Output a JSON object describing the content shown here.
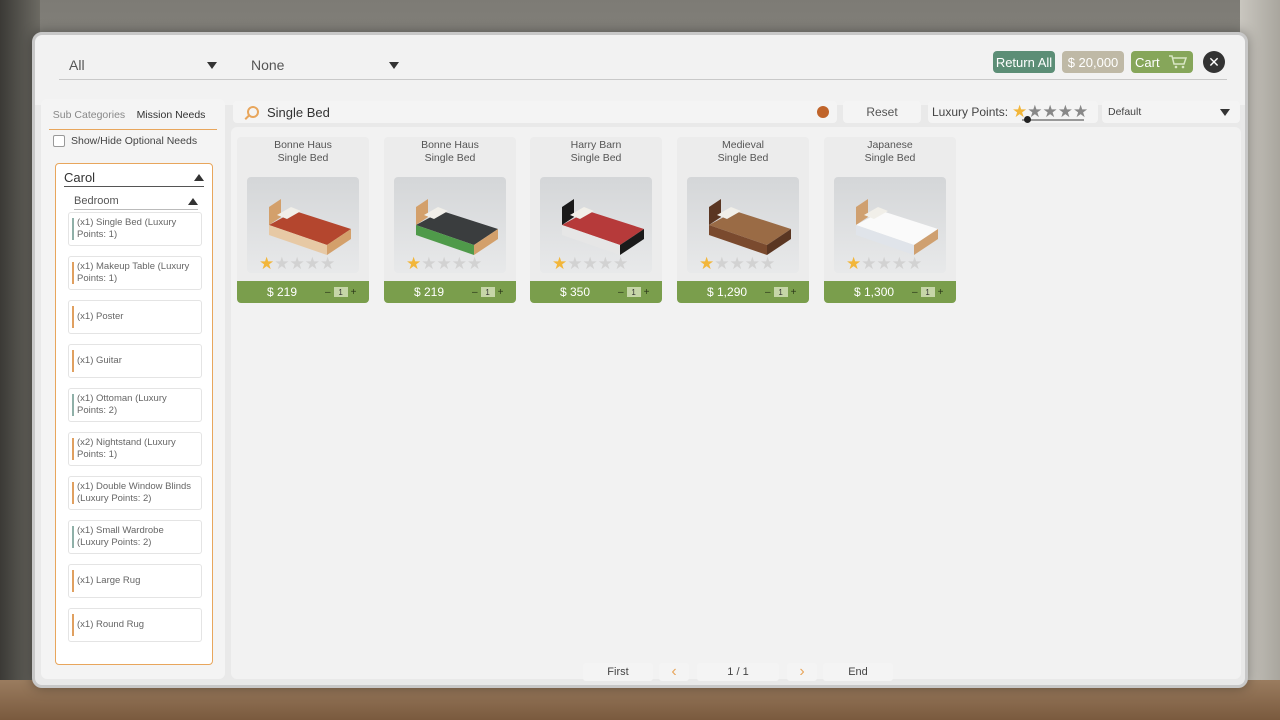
{
  "filters": {
    "category": "All",
    "subfilter": "None"
  },
  "top_actions": {
    "return_all": "Return All",
    "budget": "$ 20,000",
    "cart": "Cart",
    "close": "✕"
  },
  "sidebar": {
    "tabs": [
      "Sub Categories",
      "Mission Needs"
    ],
    "optional_toggle": "Show/Hide Optional Needs",
    "person": "Carol",
    "room": "Bedroom",
    "needs": [
      "(x1) Single Bed (Luxury Points: 1)",
      "(x1) Makeup Table (Luxury Points: 1)",
      "(x1) Poster",
      "(x1) Guitar",
      "(x1) Ottoman (Luxury Points: 2)",
      "(x2) Nightstand (Luxury Points: 1)",
      "(x1) Double Window Blinds (Luxury Points: 2)",
      "(x1) Small Wardrobe (Luxury Points: 2)",
      "(x1) Large Rug",
      "(x1) Round Rug"
    ]
  },
  "search": {
    "query": "Single Bed"
  },
  "reset": "Reset",
  "luxury": {
    "label": "Luxury Points:",
    "stars_filled": 1,
    "stars_total": 5
  },
  "sort": "Default",
  "products": [
    {
      "brand": "Bonne Haus",
      "name": "Single Bed",
      "price": "$ 219",
      "qty": "1",
      "stars": 1,
      "colors": {
        "frame": "#d3a06b",
        "bed": "#b4462e",
        "accent": "#e7c9a5"
      }
    },
    {
      "brand": "Bonne Haus",
      "name": "Single Bed",
      "price": "$ 219",
      "qty": "1",
      "stars": 1,
      "colors": {
        "frame": "#d3a06b",
        "bed": "#3a3d3e",
        "accent": "#4f9a4a"
      }
    },
    {
      "brand": "Harry Barn",
      "name": "Single Bed",
      "price": "$ 350",
      "qty": "1",
      "stars": 1,
      "colors": {
        "frame": "#1a1a1a",
        "bed": "#b63a3a",
        "accent": "#e6e6e6"
      }
    },
    {
      "brand": "Medieval",
      "name": "Single Bed",
      "price": "$ 1,290",
      "qty": "1",
      "stars": 1,
      "colors": {
        "frame": "#5a3622",
        "bed": "#9a6b45",
        "accent": "#7a4a2e"
      }
    },
    {
      "brand": "Japanese",
      "name": "Single Bed",
      "price": "$ 1,300",
      "qty": "1",
      "stars": 1,
      "colors": {
        "frame": "#cfa070",
        "bed": "#fafafa",
        "accent": "#e0e4ea"
      }
    }
  ],
  "pager": {
    "first": "First",
    "prev": "‹",
    "page": "1 / 1",
    "next": "›",
    "end": "End"
  }
}
